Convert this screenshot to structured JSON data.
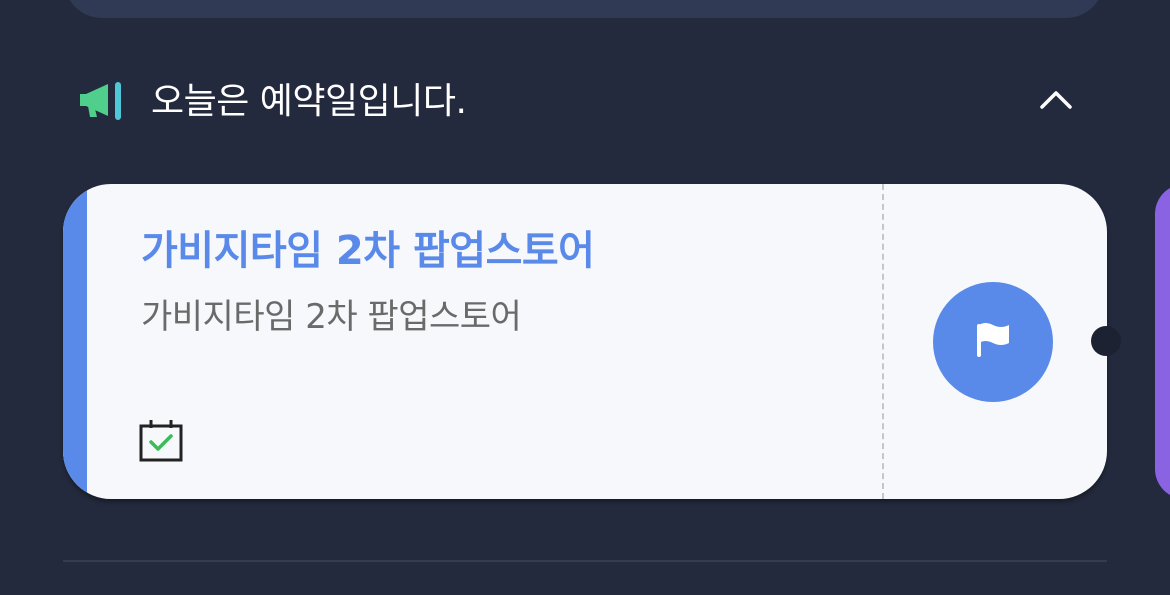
{
  "section": {
    "title": "오늘은 예약일입니다.",
    "icon": "megaphone-icon",
    "collapse_icon": "chevron-up-icon"
  },
  "reservation": {
    "title": "가비지타임 2차 팝업스토어",
    "subtitle": "가비지타임 2차 팝업스토어",
    "date_icon": "calendar-check-icon",
    "action_icon": "flag-icon"
  },
  "colors": {
    "background": "#232a3d",
    "card_background": "#f7f8fc",
    "accent_blue": "#5a8ae9",
    "accent_purple": "#8a63e3",
    "megaphone_green": "#4fcf8b",
    "megaphone_teal": "#4fc7d6",
    "calendar_check_green": "#3dbb5b"
  }
}
